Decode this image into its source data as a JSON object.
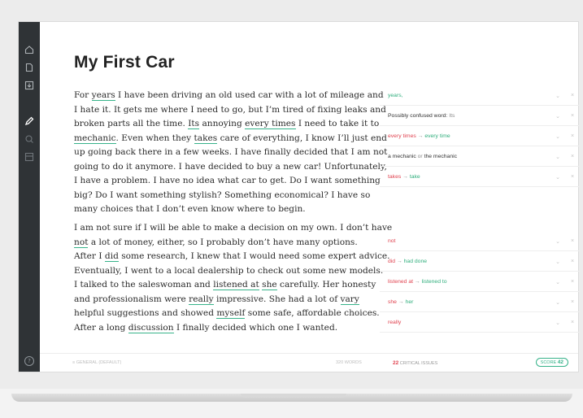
{
  "document": {
    "title": "My First Car",
    "paragraph1": [
      [
        "For ",
        {
          "u": "years"
        },
        " I have been driving an old used car with a lot of mileage and"
      ],
      [
        "I hate it. It gets me where I need to go, but I’m tired of fixing leaks and"
      ],
      [
        "broken parts all the time. ",
        {
          "u": "Its"
        },
        " annoying ",
        {
          "u": "every times"
        },
        " I need to take it to"
      ],
      [
        {
          "u": "mechanic"
        },
        ". Even when they ",
        {
          "u": "takes"
        },
        " care of everything, I know I’ll just end"
      ],
      [
        "up going back there in a few weeks. I have finally decided that I am not"
      ],
      [
        "going to do it anymore. I have decided to buy a new car! Unfortunately,"
      ],
      [
        "I have a problem. I have no idea what car to get. Do I want something"
      ],
      [
        "big? Do I want something stylish? Something economical? I have so"
      ],
      [
        "many choices that I don’t even know where to begin."
      ]
    ],
    "paragraph2": [
      [
        "I am not sure if I will be able to make a decision on my own. I don’t have"
      ],
      [
        {
          "u": "not"
        },
        "  a lot of money, either, so I probably don’t have many options."
      ],
      [
        "After I ",
        {
          "u": "did"
        },
        " some research, I knew that I would need some expert advice."
      ],
      [
        "Eventually, I went to a local dealership to check out some new models."
      ],
      [
        "I talked to the saleswoman and ",
        {
          "u": "listened at"
        },
        " ",
        {
          "u": "she"
        },
        " carefully. Her honesty"
      ],
      [
        "and professionalism were ",
        {
          "u": "really"
        },
        " impressive. She had a lot of ",
        {
          "u": "vary"
        }
      ],
      [
        "helpful suggestions and showed ",
        {
          "u": "myself"
        },
        " some safe, affordable choices."
      ],
      [
        "After a long ",
        {
          "u": "discussion"
        },
        " I finally decided which one I wanted."
      ]
    ]
  },
  "suggestions_group1": [
    {
      "parts": [
        {
          "t": "years,",
          "c": "green"
        }
      ]
    },
    {
      "parts": [
        {
          "t": "Possibly confused word: ",
          "c": "dark"
        },
        {
          "t": "Its",
          "c": "gray"
        }
      ]
    },
    {
      "parts": [
        {
          "t": "every times",
          "c": "red"
        },
        {
          "t": " → ",
          "c": "gray"
        },
        {
          "t": "every time",
          "c": "green"
        }
      ]
    },
    {
      "parts": [
        {
          "t": "a mechanic",
          "c": "dark"
        },
        {
          "t": " or ",
          "c": "gray"
        },
        {
          "t": "the mechanic",
          "c": "dark"
        }
      ]
    },
    {
      "parts": [
        {
          "t": "takes",
          "c": "red"
        },
        {
          "t": " → ",
          "c": "gray"
        },
        {
          "t": "take",
          "c": "green"
        }
      ]
    }
  ],
  "suggestions_group2": [
    {
      "parts": [
        {
          "t": "not",
          "c": "red"
        }
      ]
    },
    {
      "parts": [
        {
          "t": "did",
          "c": "red"
        },
        {
          "t": " → ",
          "c": "gray"
        },
        {
          "t": "had done",
          "c": "green"
        }
      ]
    },
    {
      "parts": [
        {
          "t": "listened at",
          "c": "red"
        },
        {
          "t": " → ",
          "c": "gray"
        },
        {
          "t": "listened to",
          "c": "green"
        }
      ]
    },
    {
      "parts": [
        {
          "t": "she",
          "c": "red"
        },
        {
          "t": " → ",
          "c": "gray"
        },
        {
          "t": "her",
          "c": "green"
        }
      ]
    },
    {
      "parts": [
        {
          "t": "really",
          "c": "red"
        }
      ]
    }
  ],
  "status": {
    "left": "≡ GENERAL (DEFAULT)",
    "middle": "320 WORDS",
    "critical_count": "22",
    "critical_label": "CRITICAL ISSUES",
    "score_label": "SCORE",
    "score_value": "42"
  },
  "icons": {
    "home": "home-icon",
    "document": "document-icon",
    "download": "download-icon",
    "pen": "pen-icon",
    "search": "search-icon",
    "panel": "panel-icon",
    "help": "help-icon",
    "help_glyph": "?"
  },
  "colors": {
    "sidebar": "#2f3336",
    "critical": "#e0424f",
    "correction": "#2fae7c",
    "underline": "#37b38a"
  }
}
